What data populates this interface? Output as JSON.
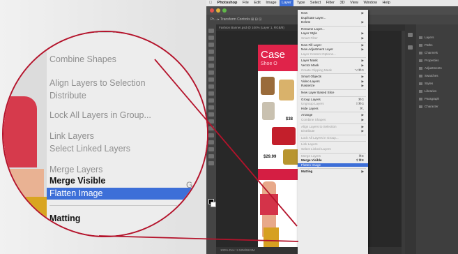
{
  "mac_menubar": {
    "app": "Photoshop",
    "items": [
      "File",
      "Edit",
      "Image",
      "Layer",
      "Type",
      "Select",
      "Filter",
      "3D",
      "View",
      "Window",
      "Help"
    ],
    "active": "Layer"
  },
  "options_bar_text": "Pr... ▸  Transform Controls  ⊞ ⊟ ⊡",
  "doc_tab": "Fashion Banner.psd @ 100% (Layer 1, RGB/8)",
  "status_text": "100%   Doc: 2.52M/98.5M",
  "right_panels": [
    "Layers",
    "Paths",
    "Channels",
    "Properties",
    "Adjustments",
    "Swatches",
    "Styles",
    "Libraries",
    "Paragraph",
    "Character"
  ],
  "doc": {
    "banner_big": "Case",
    "banner_small": "Shoe O",
    "price1": "$38",
    "price2": "$29.99"
  },
  "layer_menu": {
    "items": [
      {
        "label": "New",
        "shortcut": "▶",
        "state": "normal"
      },
      {
        "label": "Duplicate Layer...",
        "shortcut": "",
        "state": "normal"
      },
      {
        "label": "Delete",
        "shortcut": "▶",
        "state": "normal"
      },
      {
        "sep": true
      },
      {
        "label": "Rename Layer...",
        "shortcut": "",
        "state": "normal"
      },
      {
        "label": "Layer Style",
        "shortcut": "▶",
        "state": "normal"
      },
      {
        "label": "Smart Filter",
        "shortcut": "▶",
        "state": "disabled"
      },
      {
        "sep": true
      },
      {
        "label": "New Fill Layer",
        "shortcut": "▶",
        "state": "normal"
      },
      {
        "label": "New Adjustment Layer",
        "shortcut": "▶",
        "state": "normal"
      },
      {
        "label": "Layer Content Options...",
        "shortcut": "",
        "state": "disabled"
      },
      {
        "sep": true
      },
      {
        "label": "Layer Mask",
        "shortcut": "▶",
        "state": "normal"
      },
      {
        "label": "Vector Mask",
        "shortcut": "▶",
        "state": "normal"
      },
      {
        "label": "Create Clipping Mask",
        "shortcut": "⌥⌘G",
        "state": "disabled"
      },
      {
        "sep": true
      },
      {
        "label": "Smart Objects",
        "shortcut": "▶",
        "state": "normal"
      },
      {
        "label": "Video Layers",
        "shortcut": "▶",
        "state": "normal"
      },
      {
        "label": "Rasterize",
        "shortcut": "▶",
        "state": "normal"
      },
      {
        "sep": true
      },
      {
        "label": "New Layer Based Slice",
        "shortcut": "",
        "state": "normal"
      },
      {
        "sep": true
      },
      {
        "label": "Group Layers",
        "shortcut": "⌘G",
        "state": "normal"
      },
      {
        "label": "Ungroup Layers",
        "shortcut": "⇧⌘G",
        "state": "disabled"
      },
      {
        "label": "Hide Layers",
        "shortcut": "⌘,",
        "state": "normal"
      },
      {
        "sep": true
      },
      {
        "label": "Arrange",
        "shortcut": "▶",
        "state": "normal"
      },
      {
        "label": "Combine Shapes",
        "shortcut": "▶",
        "state": "disabled"
      },
      {
        "sep": true
      },
      {
        "label": "Align Layers to Selection",
        "shortcut": "▶",
        "state": "disabled"
      },
      {
        "label": "Distribute",
        "shortcut": "▶",
        "state": "disabled"
      },
      {
        "sep": true
      },
      {
        "label": "Lock All Layers in Group...",
        "shortcut": "",
        "state": "disabled"
      },
      {
        "sep": true
      },
      {
        "label": "Link Layers",
        "shortcut": "",
        "state": "disabled"
      },
      {
        "label": "Select Linked Layers",
        "shortcut": "",
        "state": "disabled"
      },
      {
        "sep": true
      },
      {
        "label": "Merge Layers",
        "shortcut": "⌘E",
        "state": "disabled"
      },
      {
        "label": "Merge Visible",
        "shortcut": "⇧⌘E",
        "state": "bold"
      },
      {
        "label": "Flatten Image",
        "shortcut": "",
        "state": "highlighted"
      },
      {
        "sep": true
      },
      {
        "label": "Matting",
        "shortcut": "▶",
        "state": "bold"
      }
    ]
  },
  "magnifier": {
    "items": [
      {
        "label": "Combine Shapes",
        "state": "disabled"
      },
      {
        "sep": true
      },
      {
        "label": "Align Layers to Selection",
        "state": "disabled"
      },
      {
        "label": "Distribute",
        "state": "disabled"
      },
      {
        "sep": true
      },
      {
        "label": "Lock All Layers in Group...",
        "state": "disabled"
      },
      {
        "sep": true
      },
      {
        "label": "Link Layers",
        "state": "disabled"
      },
      {
        "label": "Select Linked Layers",
        "state": "disabled"
      },
      {
        "sep": true
      },
      {
        "label": "Merge Layers",
        "state": "disabled"
      },
      {
        "label": "Merge Visible",
        "state": "bold"
      },
      {
        "label": "Flatten Image",
        "state": "highlighted"
      },
      {
        "sep": true
      },
      {
        "label": "Matting",
        "state": "bold"
      }
    ],
    "edge_glyph": "G"
  },
  "colors": {
    "accent_red": "#b4132b",
    "menu_highlight": "#3d6fd8",
    "banner_red": "#e0234a"
  }
}
